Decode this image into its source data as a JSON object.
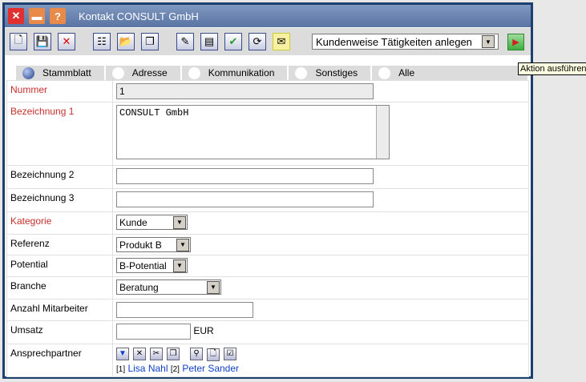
{
  "window": {
    "title": "Kontakt CONSULT GmbH"
  },
  "toolbar": {
    "action_select": "Kundenweise Tätigkeiten anlegen",
    "run_tooltip": "Aktion ausführen"
  },
  "tabs": [
    {
      "label": "Stammblatt",
      "active": true
    },
    {
      "label": "Adresse"
    },
    {
      "label": "Kommunikation"
    },
    {
      "label": "Sonstiges"
    },
    {
      "label": "Alle"
    }
  ],
  "form": {
    "nummer": {
      "label": "Nummer",
      "value": "1"
    },
    "bez1": {
      "label": "Bezeichnung 1",
      "value": "CONSULT GmbH"
    },
    "bez2": {
      "label": "Bezeichnung 2",
      "value": ""
    },
    "bez3": {
      "label": "Bezeichnung 3",
      "value": ""
    },
    "kategorie": {
      "label": "Kategorie",
      "value": "Kunde"
    },
    "referenz": {
      "label": "Referenz",
      "value": "Produkt B"
    },
    "potential": {
      "label": "Potential",
      "value": "B-Potential"
    },
    "branche": {
      "label": "Branche",
      "value": "Beratung"
    },
    "mitarbeiter": {
      "label": "Anzahl Mitarbeiter",
      "value": ""
    },
    "umsatz": {
      "label": "Umsatz",
      "value": "",
      "unit": "EUR"
    },
    "ansprech": {
      "label": "Ansprechpartner",
      "contacts": [
        {
          "index": "[1]",
          "name": "Lisa Nahl"
        },
        {
          "index": "[2]",
          "name": "Peter Sander"
        }
      ]
    }
  }
}
